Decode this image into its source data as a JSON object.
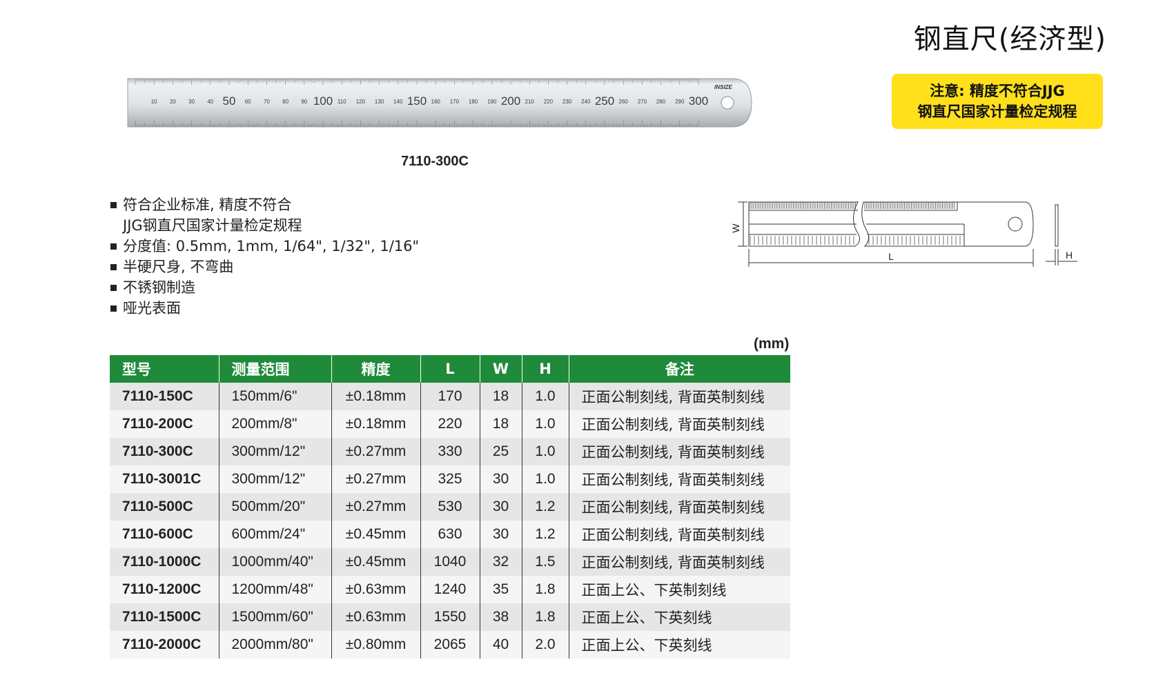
{
  "title": "钢直尺(经济型)",
  "notice": {
    "line1": "注意: 精度不符合JJG",
    "line2": "钢直尺国家计量检定规程"
  },
  "ruler": {
    "brand": "INSIZE",
    "caption": "7110-300C",
    "small_labels": [
      "10",
      "20",
      "30",
      "40",
      "60",
      "70",
      "80",
      "90",
      "110",
      "120",
      "130",
      "140",
      "160",
      "170",
      "180",
      "190",
      "210",
      "220",
      "230",
      "240",
      "260",
      "270",
      "280",
      "290"
    ],
    "big_labels": [
      "50",
      "100",
      "150",
      "200",
      "250",
      "300"
    ]
  },
  "features": {
    "item1_line1": "符合企业标准, 精度不符合",
    "item1_line2": "JJG钢直尺国家计量检定规程",
    "item2": "分度值: 0.5mm, 1mm, 1/64\", 1/32\", 1/16\"",
    "item3": "半硬尺身, 不弯曲",
    "item4": "不锈钢制造",
    "item5": "哑光表面"
  },
  "diagram": {
    "w_label": "W",
    "l_label": "L",
    "h_label": "H"
  },
  "unit": "(mm)",
  "table": {
    "headers": [
      "型号",
      "测量范围",
      "精度",
      "L",
      "W",
      "H",
      "备注"
    ],
    "rows": [
      [
        "7110-150C",
        "150mm/6\"",
        "±0.18mm",
        "170",
        "18",
        "1.0",
        "正面公制刻线, 背面英制刻线"
      ],
      [
        "7110-200C",
        "200mm/8\"",
        "±0.18mm",
        "220",
        "18",
        "1.0",
        "正面公制刻线, 背面英制刻线"
      ],
      [
        "7110-300C",
        "300mm/12\"",
        "±0.27mm",
        "330",
        "25",
        "1.0",
        "正面公制刻线, 背面英制刻线"
      ],
      [
        "7110-3001C",
        "300mm/12\"",
        "±0.27mm",
        "325",
        "30",
        "1.0",
        "正面公制刻线, 背面英制刻线"
      ],
      [
        "7110-500C",
        "500mm/20\"",
        "±0.27mm",
        "530",
        "30",
        "1.2",
        "正面公制刻线, 背面英制刻线"
      ],
      [
        "7110-600C",
        "600mm/24\"",
        "±0.45mm",
        "630",
        "30",
        "1.2",
        "正面公制刻线, 背面英制刻线"
      ],
      [
        "7110-1000C",
        "1000mm/40\"",
        "±0.45mm",
        "1040",
        "32",
        "1.5",
        "正面公制刻线, 背面英制刻线"
      ],
      [
        "7110-1200C",
        "1200mm/48\"",
        "±0.63mm",
        "1240",
        "35",
        "1.8",
        "正面上公、下英制刻线"
      ],
      [
        "7110-1500C",
        "1500mm/60\"",
        "±0.63mm",
        "1550",
        "38",
        "1.8",
        "正面上公、下英刻线"
      ],
      [
        "7110-2000C",
        "2000mm/80\"",
        "±0.80mm",
        "2065",
        "40",
        "2.0",
        "正面上公、下英刻线"
      ]
    ]
  },
  "colors": {
    "header_green": "#1f8a3a",
    "notice_yellow": "#ffe01a",
    "row_odd": "#e6e6e6",
    "row_even": "#f5f5f5"
  }
}
